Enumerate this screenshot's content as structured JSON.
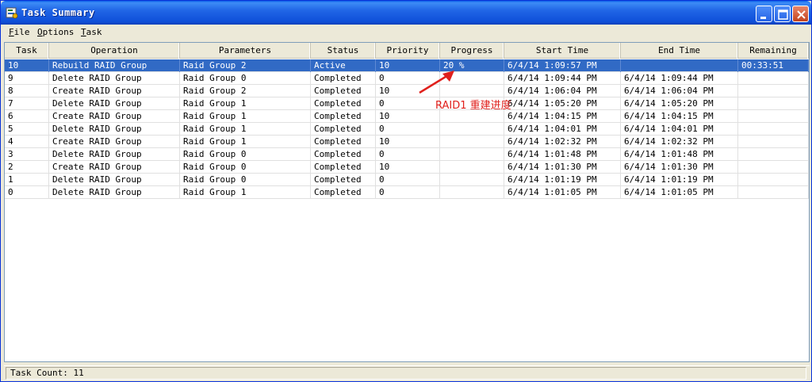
{
  "window": {
    "title": "Task Summary"
  },
  "menu": [
    {
      "underline": "F",
      "rest": "ile"
    },
    {
      "underline": "O",
      "rest": "ptions"
    },
    {
      "underline": "T",
      "rest": "ask"
    }
  ],
  "columns": [
    "Task",
    "Operation",
    "Parameters",
    "Status",
    "Priority",
    "Progress",
    "Start Time",
    "End Time",
    "Remaining"
  ],
  "rows": [
    {
      "task": "10",
      "operation": "Rebuild RAID Group",
      "parameters": "Raid Group 2",
      "status": "Active",
      "priority": "10",
      "progress": "20 %",
      "start": "6/4/14 1:09:57 PM",
      "end": "",
      "remaining": "00:33:51",
      "selected": true
    },
    {
      "task": "9",
      "operation": "Delete RAID Group",
      "parameters": "Raid Group 0",
      "status": "Completed",
      "priority": "0",
      "progress": "",
      "start": "6/4/14 1:09:44 PM",
      "end": "6/4/14 1:09:44 PM",
      "remaining": ""
    },
    {
      "task": "8",
      "operation": "Create RAID Group",
      "parameters": "Raid Group 2",
      "status": "Completed",
      "priority": "10",
      "progress": "",
      "start": "6/4/14 1:06:04 PM",
      "end": "6/4/14 1:06:04 PM",
      "remaining": ""
    },
    {
      "task": "7",
      "operation": "Delete RAID Group",
      "parameters": "Raid Group 1",
      "status": "Completed",
      "priority": "0",
      "progress": "",
      "start": "6/4/14 1:05:20 PM",
      "end": "6/4/14 1:05:20 PM",
      "remaining": ""
    },
    {
      "task": "6",
      "operation": "Create RAID Group",
      "parameters": "Raid Group 1",
      "status": "Completed",
      "priority": "10",
      "progress": "",
      "start": "6/4/14 1:04:15 PM",
      "end": "6/4/14 1:04:15 PM",
      "remaining": ""
    },
    {
      "task": "5",
      "operation": "Delete RAID Group",
      "parameters": "Raid Group 1",
      "status": "Completed",
      "priority": "0",
      "progress": "",
      "start": "6/4/14 1:04:01 PM",
      "end": "6/4/14 1:04:01 PM",
      "remaining": ""
    },
    {
      "task": "4",
      "operation": "Create RAID Group",
      "parameters": "Raid Group 1",
      "status": "Completed",
      "priority": "10",
      "progress": "",
      "start": "6/4/14 1:02:32 PM",
      "end": "6/4/14 1:02:32 PM",
      "remaining": ""
    },
    {
      "task": "3",
      "operation": "Delete RAID Group",
      "parameters": "Raid Group 0",
      "status": "Completed",
      "priority": "0",
      "progress": "",
      "start": "6/4/14 1:01:48 PM",
      "end": "6/4/14 1:01:48 PM",
      "remaining": ""
    },
    {
      "task": "2",
      "operation": "Create RAID Group",
      "parameters": "Raid Group 0",
      "status": "Completed",
      "priority": "10",
      "progress": "",
      "start": "6/4/14 1:01:30 PM",
      "end": "6/4/14 1:01:30 PM",
      "remaining": ""
    },
    {
      "task": "1",
      "operation": "Delete RAID Group",
      "parameters": "Raid Group 0",
      "status": "Completed",
      "priority": "0",
      "progress": "",
      "start": "6/4/14 1:01:19 PM",
      "end": "6/4/14 1:01:19 PM",
      "remaining": ""
    },
    {
      "task": "0",
      "operation": "Delete RAID Group",
      "parameters": "Raid Group 1",
      "status": "Completed",
      "priority": "0",
      "progress": "",
      "start": "6/4/14 1:01:05 PM",
      "end": "6/4/14 1:01:05 PM",
      "remaining": ""
    }
  ],
  "annotation": {
    "text": "RAID1 重建进度",
    "color": "#e0201c"
  },
  "statusbar": {
    "text": "Task Count: 11"
  },
  "colors": {
    "titlebar": "#0a5fe8",
    "selection": "#316ac5"
  },
  "icons": {
    "app": "task-summary-icon",
    "minimize": "minimize-icon",
    "maximize": "maximize-icon",
    "close": "close-icon"
  }
}
